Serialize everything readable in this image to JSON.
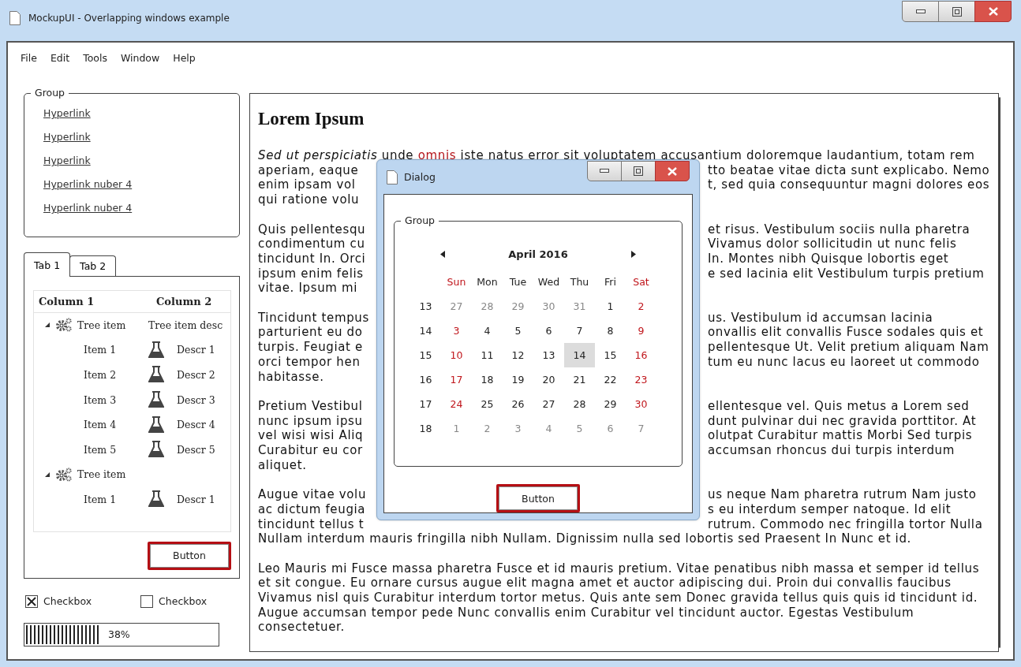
{
  "window": {
    "title": "MockupUI - Overlapping windows example"
  },
  "menu": [
    "File",
    "Edit",
    "Tools",
    "Window",
    "Help"
  ],
  "group": {
    "title": "Group",
    "links": [
      "Hyperlink",
      "Hyperlink",
      "Hyperlink",
      "Hyperlink nuber 4",
      "Hyperlink nuber 4"
    ]
  },
  "tabs": [
    {
      "label": "Tab 1",
      "selected": true
    },
    {
      "label": "Tab 2",
      "selected": false
    }
  ],
  "tree": {
    "columns": [
      "Column 1",
      "Column 2"
    ],
    "items": [
      {
        "label": "Tree item",
        "description": "Tree item desc",
        "expanded": true,
        "children": [
          {
            "label": "Item 1",
            "description": "Descr 1"
          },
          {
            "label": "Item 2",
            "description": "Descr 2"
          },
          {
            "label": "Item 3",
            "description": "Descr 3"
          },
          {
            "label": "Item 4",
            "description": "Descr 4"
          },
          {
            "label": "Item 5",
            "description": "Descr 5"
          }
        ]
      },
      {
        "label": "Tree item",
        "expanded": true,
        "children": [
          {
            "label": "Item 1",
            "description": "Descr 1"
          }
        ]
      }
    ]
  },
  "button": "Button",
  "checkboxes": [
    {
      "label": "Checkbox",
      "checked": true
    },
    {
      "label": "Checkbox",
      "checked": false
    }
  ],
  "progress": {
    "level": 0.38,
    "label": "38%"
  },
  "document": {
    "heading": "Lorem Ipsum",
    "paragraphs": [
      [
        {
          "segments": [
            {
              "kind": "italic",
              "text": "Sed ut perspiciatis"
            },
            {
              "kind": "plain",
              "text": " unde "
            },
            {
              "kind": "link",
              "text": "omnis"
            },
            {
              "kind": "plain",
              "text": " iste natus error sit voluptatem accusantium doloremque laudantium, totam rem"
            }
          ]
        },
        {
          "left": "aperiam, eaque",
          "right": "tto beatae vitae dicta sunt explicabo. Nemo"
        },
        {
          "left": "enim ipsam vol",
          "right": "t, sed quia consequuntur magni dolores eos"
        },
        {
          "left": "qui ratione volu"
        }
      ],
      [
        {
          "left": "Quis pellentesqu",
          "right": "et risus. Vestibulum sociis nulla pharetra"
        },
        {
          "left": "condimentum cu",
          "right": "Vivamus dolor sollicitudin ut nunc felis"
        },
        {
          "left": "tincidunt In. Orci",
          "right": "In. Montes nibh Quisque lobortis eget"
        },
        {
          "left": "ipsum enim felis",
          "right": "e sed lacinia elit Vestibulum turpis pretium"
        },
        {
          "left": "vitae. Ipsum mi"
        }
      ],
      [
        {
          "left": "Tincidunt tempus",
          "right": "us. Vestibulum id accumsan lacinia"
        },
        {
          "left": "parturient eu do",
          "right": "onvallis elit convallis Fusce sodales quis et"
        },
        {
          "left": "turpis. Feugiat e",
          "right": "pellentesque Ut. Velit pretium aliquam Nam"
        },
        {
          "left": "orci tempor hen",
          "right": "tum eu nunc lacus eu laoreet ut commodo"
        },
        {
          "left": "habitasse."
        }
      ],
      [
        {
          "left": "Pretium Vestibul",
          "right": "ellentesque vel. Quis metus a Lorem sed"
        },
        {
          "left": "nunc ipsum ipsu",
          "right": "dunt pulvinar dui nec gravida porttitor. At"
        },
        {
          "left": "vel wisi wisi Aliq",
          "right": "olutpat Curabitur mattis Morbi Sed turpis"
        },
        {
          "left": "Curabitur eu cor",
          "right": "accumsan rhoncus dui turpis interdum"
        },
        {
          "left": "aliquet."
        }
      ],
      [
        {
          "left": "Augue vitae volu",
          "right": "us neque Nam pharetra rutrum Nam justo"
        },
        {
          "left": "ac dictum feugia",
          "right": "s eu interdum semper natoque. Id elit"
        },
        {
          "left": "tincidunt tellus t",
          "right": "rutrum. Commodo nec fringilla tortor Nulla"
        },
        {
          "left": "Nullam interdum mauris fringilla nibh Nullam. Dignissim nulla sed lobortis sed Praesent In Nunc et id."
        }
      ],
      [
        {
          "left": "Leo Mauris mi Fusce massa pharetra Fusce et id mauris pretium. Vitae penatibus nibh massa et semper id tellus"
        },
        {
          "left": "et sit congue. Eu ornare cursus augue elit magna amet et auctor adipiscing dui. Proin dui convallis faucibus"
        },
        {
          "left": "Vivamus nisl quis Curabitur interdum tortor metus. Quis ante sem Donec gravida tellus quis quis id tincidunt id."
        },
        {
          "left": "Augue accumsan tempor pede Nunc convallis enim Curabitur vel tincidunt auctor. Egestas Vestibulum"
        },
        {
          "left": "consectetuer."
        }
      ]
    ]
  },
  "dialog": {
    "title": "Dialog",
    "group_title": "Group",
    "month": "April 2016",
    "button": "Button",
    "weekdays": [
      {
        "label": "Sun",
        "weekend": true
      },
      {
        "label": "Mon",
        "weekend": false
      },
      {
        "label": "Tue",
        "weekend": false
      },
      {
        "label": "Wed",
        "weekend": false
      },
      {
        "label": "Thu",
        "weekend": false
      },
      {
        "label": "Fri",
        "weekend": false
      },
      {
        "label": "Sat",
        "weekend": true
      }
    ],
    "weeks": [
      {
        "week": "13",
        "days": [
          {
            "text": "27",
            "muted": true,
            "selected": false
          },
          {
            "text": "28",
            "muted": true,
            "selected": false
          },
          {
            "text": "29",
            "muted": true,
            "selected": false
          },
          {
            "text": "30",
            "muted": true,
            "selected": false
          },
          {
            "text": "31",
            "muted": true,
            "selected": false
          },
          {
            "text": "1",
            "muted": false,
            "selected": false
          },
          {
            "text": "2",
            "muted": false,
            "selected": false
          }
        ]
      },
      {
        "week": "14",
        "days": [
          {
            "text": "3",
            "muted": false,
            "selected": false
          },
          {
            "text": "4",
            "muted": false,
            "selected": false
          },
          {
            "text": "5",
            "muted": false,
            "selected": false
          },
          {
            "text": "6",
            "muted": false,
            "selected": false
          },
          {
            "text": "7",
            "muted": false,
            "selected": false
          },
          {
            "text": "8",
            "muted": false,
            "selected": false
          },
          {
            "text": "9",
            "muted": false,
            "selected": false
          }
        ]
      },
      {
        "week": "15",
        "days": [
          {
            "text": "10",
            "muted": false,
            "selected": false
          },
          {
            "text": "11",
            "muted": false,
            "selected": false
          },
          {
            "text": "12",
            "muted": false,
            "selected": false
          },
          {
            "text": "13",
            "muted": false,
            "selected": false
          },
          {
            "text": "14",
            "muted": false,
            "selected": true
          },
          {
            "text": "15",
            "muted": false,
            "selected": false
          },
          {
            "text": "16",
            "muted": false,
            "selected": false
          }
        ]
      },
      {
        "week": "16",
        "days": [
          {
            "text": "17",
            "muted": false,
            "selected": false
          },
          {
            "text": "18",
            "muted": false,
            "selected": false
          },
          {
            "text": "19",
            "muted": false,
            "selected": false
          },
          {
            "text": "20",
            "muted": false,
            "selected": false
          },
          {
            "text": "21",
            "muted": false,
            "selected": false
          },
          {
            "text": "22",
            "muted": false,
            "selected": false
          },
          {
            "text": "23",
            "muted": false,
            "selected": false
          }
        ]
      },
      {
        "week": "17",
        "days": [
          {
            "text": "24",
            "muted": false,
            "selected": false
          },
          {
            "text": "25",
            "muted": false,
            "selected": false
          },
          {
            "text": "26",
            "muted": false,
            "selected": false
          },
          {
            "text": "27",
            "muted": false,
            "selected": false
          },
          {
            "text": "28",
            "muted": false,
            "selected": false
          },
          {
            "text": "29",
            "muted": false,
            "selected": false
          },
          {
            "text": "30",
            "muted": false,
            "selected": false
          }
        ]
      },
      {
        "week": "18",
        "days": [
          {
            "text": "1",
            "muted": true,
            "selected": false
          },
          {
            "text": "2",
            "muted": true,
            "selected": false
          },
          {
            "text": "3",
            "muted": true,
            "selected": false
          },
          {
            "text": "4",
            "muted": true,
            "selected": false
          },
          {
            "text": "5",
            "muted": true,
            "selected": false
          },
          {
            "text": "6",
            "muted": true,
            "selected": false
          },
          {
            "text": "7",
            "muted": true,
            "selected": false
          }
        ]
      }
    ]
  }
}
